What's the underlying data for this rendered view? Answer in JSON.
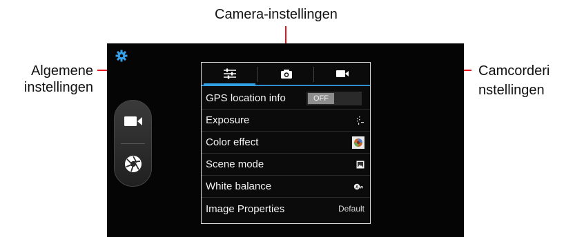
{
  "callouts": {
    "top": "Camera-instellingen",
    "left": [
      "Algemene",
      "instellingen"
    ],
    "right": [
      "Camcorderi",
      "nstellingen"
    ]
  },
  "colors": {
    "callout_line": "#e8141c",
    "accent": "#33a2e5",
    "gear": "#38a0e8"
  },
  "icons": {
    "gear": "gear-icon",
    "side_video": "video-camera-icon",
    "side_shutter": "shutter-icon",
    "tab_general": "sliders-icon",
    "tab_camera": "camera-icon",
    "tab_camcorder": "video-camera-icon"
  },
  "tabs": [
    {
      "id": "general",
      "selected": true
    },
    {
      "id": "camera",
      "selected": false
    },
    {
      "id": "camcorder",
      "selected": false
    }
  ],
  "settings": [
    {
      "label": "GPS location info",
      "value": "OFF",
      "kind": "toggle"
    },
    {
      "label": "Exposure",
      "icon": "exposure-icon"
    },
    {
      "label": "Color effect",
      "icon": "color-effect-icon"
    },
    {
      "label": "Scene mode",
      "icon": "scene-mode-icon"
    },
    {
      "label": "White balance",
      "icon": "auto-white-balance-icon"
    },
    {
      "label": "Image Properties",
      "value": "Default"
    }
  ]
}
